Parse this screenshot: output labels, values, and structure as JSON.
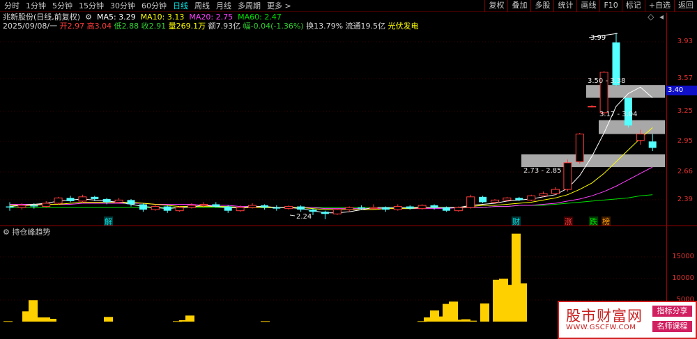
{
  "toolbar": {
    "tabs": [
      "分时",
      "1分钟",
      "5分钟",
      "15分钟",
      "30分钟",
      "60分钟",
      "日线",
      "周线",
      "月线",
      "多周期",
      "更多 >"
    ],
    "active_tab": "日线",
    "right_tools": [
      "复权",
      "叠加",
      "多股",
      "统计",
      "画线",
      "F10",
      "标记",
      "+自选",
      "返回"
    ]
  },
  "quote": {
    "name": "兆新股份(日线,前复权)",
    "ma5_label": "MA5: 3.29",
    "ma10_label": "MA10: 3.13",
    "ma20_label": "MA20: 2.75",
    "ma60_label": "MA60: 2.47",
    "date": "2025/09/08/一",
    "open": "开2.97",
    "high": "高3.04",
    "low": "低2.88",
    "close": "收2.91",
    "volume": "量269.1万",
    "amount": "额7.93亿",
    "change": "幅-0.04(-1.36%)",
    "turnover": "换13.79%",
    "float_cap": "流通19.5亿",
    "concept": "光伏发电"
  },
  "price_axis": {
    "ticks": [
      "3.93",
      "3.57",
      "3.25",
      "2.95",
      "2.66",
      "2.39"
    ],
    "current": "3.40"
  },
  "volume_axis": {
    "ticks": [
      "15000",
      "10000",
      "5000"
    ]
  },
  "indicator": {
    "title": "持仓峰趋势"
  },
  "annotations": {
    "high": "3.99",
    "zone1": "3.50 - 3.38",
    "zone2": "3.17 - 3.04",
    "zone3": "2.73 - 2.85",
    "low": "2.24"
  },
  "markers": {
    "jie": "解",
    "cai": "财",
    "zhang": "涨",
    "die": "跌",
    "bang": "榜"
  },
  "logo": {
    "main": "股市财富网",
    "url": "WWW.GSCFW.COM",
    "badge1": "指标分享",
    "badge2": "名师课程"
  },
  "colors": {
    "up": "#ff3c3c",
    "down": "#54ffff",
    "ma5": "#ffffff",
    "ma10": "#ffff00",
    "ma20": "#ff40ff",
    "ma60": "#00e000",
    "volume_bar": "#ffd000"
  },
  "chart_data": {
    "type": "candlestick",
    "ylim": [
      2.22,
      4.05
    ],
    "candles": [
      [
        2.36,
        2.35,
        2.4,
        2.32
      ],
      [
        2.35,
        2.37,
        2.39,
        2.33
      ],
      [
        2.37,
        2.36,
        2.39,
        2.34
      ],
      [
        2.36,
        2.39,
        2.41,
        2.35
      ],
      [
        2.39,
        2.44,
        2.45,
        2.38
      ],
      [
        2.44,
        2.41,
        2.46,
        2.4
      ],
      [
        2.41,
        2.45,
        2.47,
        2.4
      ],
      [
        2.45,
        2.43,
        2.46,
        2.41
      ],
      [
        2.43,
        2.4,
        2.44,
        2.38
      ],
      [
        2.4,
        2.42,
        2.44,
        2.39
      ],
      [
        2.42,
        2.38,
        2.43,
        2.36
      ],
      [
        2.38,
        2.33,
        2.39,
        2.31
      ],
      [
        2.33,
        2.36,
        2.38,
        2.32
      ],
      [
        2.36,
        2.32,
        2.37,
        2.3
      ],
      [
        2.32,
        2.35,
        2.36,
        2.31
      ],
      [
        2.35,
        2.37,
        2.39,
        2.34
      ],
      [
        2.37,
        2.38,
        2.4,
        2.35
      ],
      [
        2.38,
        2.36,
        2.4,
        2.35
      ],
      [
        2.36,
        2.32,
        2.37,
        2.3
      ],
      [
        2.32,
        2.35,
        2.37,
        2.31
      ],
      [
        2.35,
        2.37,
        2.39,
        2.34
      ],
      [
        2.37,
        2.35,
        2.38,
        2.33
      ],
      [
        2.35,
        2.34,
        2.37,
        2.32
      ],
      [
        2.34,
        2.36,
        2.37,
        2.33
      ],
      [
        2.36,
        2.33,
        2.37,
        2.31
      ],
      [
        2.33,
        2.31,
        2.34,
        2.28
      ],
      [
        2.31,
        2.29,
        2.32,
        2.24
      ],
      [
        2.29,
        2.33,
        2.34,
        2.28
      ],
      [
        2.33,
        2.35,
        2.36,
        2.31
      ],
      [
        2.35,
        2.34,
        2.37,
        2.33
      ],
      [
        2.34,
        2.35,
        2.38,
        2.33
      ],
      [
        2.35,
        2.33,
        2.36,
        2.31
      ],
      [
        2.33,
        2.36,
        2.38,
        2.32
      ],
      [
        2.36,
        2.34,
        2.37,
        2.33
      ],
      [
        2.34,
        2.37,
        2.38,
        2.33
      ],
      [
        2.37,
        2.35,
        2.38,
        2.33
      ],
      [
        2.35,
        2.32,
        2.36,
        2.31
      ],
      [
        2.32,
        2.35,
        2.36,
        2.31
      ],
      [
        2.35,
        2.45,
        2.47,
        2.34
      ],
      [
        2.45,
        2.4,
        2.46,
        2.39
      ],
      [
        2.4,
        2.42,
        2.43,
        2.39
      ],
      [
        2.42,
        2.44,
        2.45,
        2.41
      ],
      [
        2.44,
        2.42,
        2.45,
        2.41
      ],
      [
        2.42,
        2.46,
        2.47,
        2.41
      ],
      [
        2.46,
        2.48,
        2.5,
        2.45
      ],
      [
        2.48,
        2.52,
        2.54,
        2.47
      ],
      [
        2.52,
        2.77,
        2.8,
        2.5
      ],
      [
        2.78,
        3.04,
        3.05,
        2.76
      ],
      [
        3.3,
        3.3,
        3.31,
        3.29
      ],
      [
        3.24,
        3.62,
        3.63,
        3.22
      ],
      [
        3.9,
        3.5,
        3.99,
        3.49
      ],
      [
        3.38,
        3.12,
        3.38,
        3.1
      ],
      [
        2.98,
        3.04,
        3.08,
        2.94
      ],
      [
        2.97,
        2.91,
        3.04,
        2.88
      ]
    ],
    "ma5": [
      2.36,
      2.37,
      2.38,
      2.39,
      2.41,
      2.42,
      2.43,
      2.42,
      2.41,
      2.4,
      2.38,
      2.36,
      2.35,
      2.34,
      2.35,
      2.36,
      2.37,
      2.36,
      2.35,
      2.35,
      2.36,
      2.36,
      2.35,
      2.35,
      2.34,
      2.32,
      2.3,
      2.3,
      2.31,
      2.33,
      2.35,
      2.35,
      2.35,
      2.35,
      2.35,
      2.35,
      2.35,
      2.35,
      2.37,
      2.38,
      2.39,
      2.41,
      2.42,
      2.43,
      2.45,
      2.47,
      2.53,
      2.65,
      2.83,
      3.05,
      3.3,
      3.42,
      3.48,
      3.38
    ],
    "ma10": [
      2.37,
      2.37,
      2.37,
      2.38,
      2.38,
      2.39,
      2.4,
      2.4,
      2.4,
      2.4,
      2.4,
      2.39,
      2.38,
      2.37,
      2.36,
      2.36,
      2.36,
      2.36,
      2.36,
      2.35,
      2.35,
      2.35,
      2.35,
      2.35,
      2.35,
      2.34,
      2.33,
      2.33,
      2.33,
      2.33,
      2.33,
      2.34,
      2.34,
      2.34,
      2.35,
      2.35,
      2.35,
      2.35,
      2.36,
      2.37,
      2.37,
      2.38,
      2.39,
      2.4,
      2.42,
      2.44,
      2.47,
      2.52,
      2.58,
      2.67,
      2.78,
      2.89,
      3.0,
      3.1
    ],
    "ma20": [
      2.38,
      2.38,
      2.38,
      2.38,
      2.38,
      2.38,
      2.39,
      2.39,
      2.39,
      2.39,
      2.39,
      2.39,
      2.38,
      2.38,
      2.38,
      2.38,
      2.37,
      2.37,
      2.37,
      2.36,
      2.36,
      2.36,
      2.35,
      2.35,
      2.35,
      2.35,
      2.34,
      2.34,
      2.34,
      2.34,
      2.34,
      2.34,
      2.34,
      2.34,
      2.34,
      2.34,
      2.34,
      2.35,
      2.35,
      2.35,
      2.36,
      2.36,
      2.37,
      2.37,
      2.38,
      2.39,
      2.41,
      2.43,
      2.46,
      2.5,
      2.55,
      2.61,
      2.67,
      2.73
    ],
    "ma60": [
      2.35,
      2.35,
      2.35,
      2.35,
      2.35,
      2.35,
      2.35,
      2.35,
      2.35,
      2.35,
      2.35,
      2.35,
      2.35,
      2.35,
      2.35,
      2.35,
      2.35,
      2.35,
      2.35,
      2.35,
      2.35,
      2.35,
      2.35,
      2.35,
      2.35,
      2.35,
      2.35,
      2.35,
      2.35,
      2.35,
      2.35,
      2.35,
      2.35,
      2.35,
      2.35,
      2.35,
      2.35,
      2.35,
      2.35,
      2.35,
      2.36,
      2.36,
      2.37,
      2.37,
      2.37,
      2.38,
      2.39,
      2.4,
      2.41,
      2.42,
      2.43,
      2.44,
      2.46,
      2.47
    ],
    "indicator_ylim": [
      0,
      19000
    ],
    "indicator_values": [
      100,
      0,
      0,
      2200,
      4600,
      900,
      900,
      600,
      0,
      0,
      0,
      0,
      0,
      0,
      0,
      0,
      1000,
      0,
      0,
      0,
      0,
      0,
      0,
      0,
      0,
      0,
      0,
      100,
      300,
      1300,
      0,
      0,
      0,
      0,
      0,
      0,
      0,
      0,
      0,
      0,
      0,
      100,
      0,
      0,
      0,
      0,
      0,
      0,
      0,
      0,
      0,
      0,
      0,
      0,
      0,
      0,
      0,
      0,
      0,
      0,
      0,
      0,
      0,
      0,
      0,
      0,
      100,
      900,
      2400,
      1100,
      3800,
      4300,
      400,
      500,
      200,
      0,
      3900,
      0,
      9000,
      9200,
      7900,
      18900,
      8200,
      0
    ]
  }
}
